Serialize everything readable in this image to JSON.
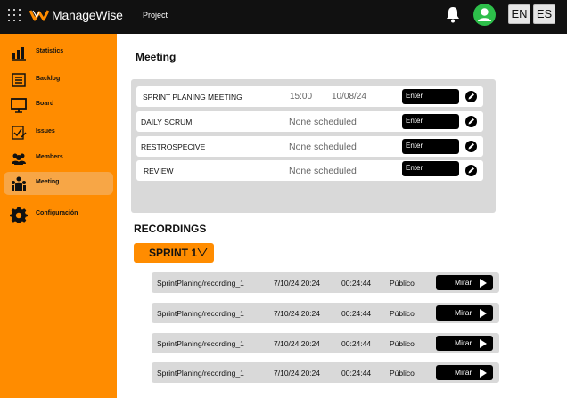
{
  "header": {
    "app_name": "ManageWise",
    "project_label": "Project",
    "lang_en": "EN",
    "lang_es": "ES",
    "brand_color": "#ff8c00",
    "avatar_color": "#2dbf4a"
  },
  "sidebar": {
    "items": [
      {
        "label": "Statistics",
        "icon": "bar-chart-icon"
      },
      {
        "label": "Backlog",
        "icon": "backlog-icon"
      },
      {
        "label": "Board",
        "icon": "board-icon"
      },
      {
        "label": "Issues",
        "icon": "issues-icon"
      },
      {
        "label": "Members",
        "icon": "members-icon"
      },
      {
        "label": "Meeting",
        "icon": "meeting-icon",
        "active": true
      },
      {
        "label": "Configuración",
        "icon": "gear-icon"
      }
    ]
  },
  "meeting": {
    "title": "Meeting",
    "rows": [
      {
        "name": "SPRINT PLANING MEETING",
        "time": "15:00",
        "date": "10/08/24",
        "enter": "Enter"
      },
      {
        "name": "DAILY  SCRUM",
        "status": "None scheduled",
        "enter": "Enter"
      },
      {
        "name": "RESTROSPECIVE",
        "status": "None scheduled",
        "enter": "Enter"
      },
      {
        "name": "REVIEW",
        "status": "None scheduled",
        "enter": "Enter"
      }
    ]
  },
  "recordings": {
    "title": "RECORDINGS",
    "sprint_selector": "SPRINT 1",
    "rows": [
      {
        "file": "SprintPlaning/recording_1",
        "datetime": "7/10/24 20:24",
        "duration": "00:24:44",
        "visibility": "Público",
        "action": "Mirar"
      },
      {
        "file": "SprintPlaning/recording_1",
        "datetime": "7/10/24 20:24",
        "duration": "00:24:44",
        "visibility": "Público",
        "action": "Mirar"
      },
      {
        "file": "SprintPlaning/recording_1",
        "datetime": "7/10/24 20:24",
        "duration": "00:24:44",
        "visibility": "Público",
        "action": "Mirar"
      },
      {
        "file": "SprintPlaning/recording_1",
        "datetime": "7/10/24 20:24",
        "duration": "00:24:44",
        "visibility": "Público",
        "action": "Mirar"
      }
    ]
  }
}
